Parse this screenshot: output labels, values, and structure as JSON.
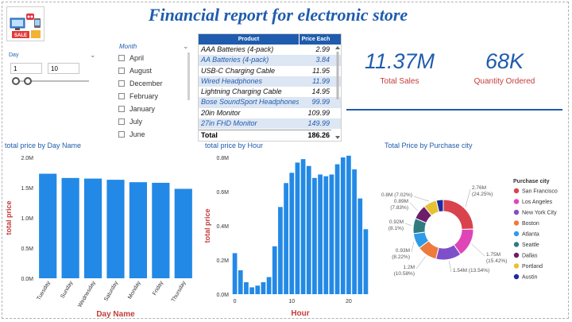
{
  "title": "Financial report for electronic store",
  "logo": {
    "badge_text": "SALE"
  },
  "day_filter": {
    "label": "Day",
    "min": "1",
    "max": "10"
  },
  "month_filter": {
    "label": "Month",
    "items": [
      "April",
      "August",
      "December",
      "February",
      "January",
      "July",
      "June"
    ]
  },
  "product_table": {
    "headers": [
      "Product",
      "Price Each"
    ],
    "rows": [
      [
        "AAA Batteries (4-pack)",
        "2.99"
      ],
      [
        "AA Batteries (4-pack)",
        "3.84"
      ],
      [
        "USB-C Charging Cable",
        "11.95"
      ],
      [
        "Wired Headphones",
        "11.99"
      ],
      [
        "Lightning Charging Cable",
        "14.95"
      ],
      [
        "Bose SoundSport Headphones",
        "99.99"
      ],
      [
        "20in Monitor",
        "109.99"
      ],
      [
        "27in FHD Monitor",
        "149.99"
      ]
    ],
    "total_label": "Total",
    "total_value": "186.26"
  },
  "kpis": {
    "total_sales_value": "11.37M",
    "total_sales_label": "Total Sales",
    "quantity_value": "68K",
    "quantity_label": "Quantity Ordered"
  },
  "colors": {
    "accent": "#1f5cad",
    "bar": "#2389e6",
    "label_red": "#c43b3b"
  },
  "chart_data": [
    {
      "type": "bar",
      "title": "total price by Day Name",
      "xlabel": "Day Name",
      "ylabel": "total price",
      "categories": [
        "Tuesday",
        "Sunday",
        "Wednesday",
        "Saturday",
        "Monday",
        "Friday",
        "Thursday"
      ],
      "values": [
        1.73,
        1.66,
        1.65,
        1.63,
        1.59,
        1.58,
        1.48
      ],
      "ylim": [
        0,
        2.0
      ],
      "yticks": [
        "0.0M",
        "0.5M",
        "1.0M",
        "1.5M",
        "2.0M"
      ]
    },
    {
      "type": "bar",
      "title": "total price by Hour",
      "xlabel": "Hour",
      "ylabel": "total price",
      "x": [
        0,
        1,
        2,
        3,
        4,
        5,
        6,
        7,
        8,
        9,
        10,
        11,
        12,
        13,
        14,
        15,
        16,
        17,
        18,
        19,
        20,
        21,
        22,
        23
      ],
      "values": [
        0.24,
        0.14,
        0.07,
        0.04,
        0.05,
        0.07,
        0.1,
        0.28,
        0.51,
        0.65,
        0.71,
        0.77,
        0.79,
        0.75,
        0.68,
        0.7,
        0.69,
        0.7,
        0.76,
        0.8,
        0.81,
        0.73,
        0.56,
        0.38
      ],
      "ylim": [
        0,
        0.8
      ],
      "yticks": [
        "0.0M",
        "0.2M",
        "0.4M",
        "0.6M",
        "0.8M"
      ],
      "xticks": [
        "0",
        "10",
        "20"
      ]
    },
    {
      "type": "pie",
      "title": "Total Price by Purchase city",
      "legend_title": "Purchase city",
      "slices": [
        {
          "name": "San Francisco",
          "value": 2.76,
          "label": "2.76M",
          "pct": "(24.25%)",
          "color": "#d9434e"
        },
        {
          "name": "Los Angeles",
          "value": 1.75,
          "label": "1.75M",
          "pct": "(15.42%)",
          "color": "#e045b8"
        },
        {
          "name": "New York City",
          "value": 1.54,
          "label": "1.54M (13.54%)",
          "pct": "",
          "color": "#7f4fc9"
        },
        {
          "name": "Boston",
          "value": 1.2,
          "label": "1.2M",
          "pct": "(10.58%)",
          "color": "#ee7a3c"
        },
        {
          "name": "Atlanta",
          "value": 0.93,
          "label": "0.93M",
          "pct": "(8.22%)",
          "color": "#2f9be8"
        },
        {
          "name": "Seattle",
          "value": 0.92,
          "label": "0.92M",
          "pct": "(8.1%)",
          "color": "#2f7b80"
        },
        {
          "name": "Dallas",
          "value": 0.89,
          "label": "0.89M",
          "pct": "(7.83%)",
          "color": "#6d1e6a"
        },
        {
          "name": "Portland",
          "value": 0.8,
          "label": "0.8M (7.02%)",
          "pct": "",
          "color": "#e6c233"
        },
        {
          "name": "Austin",
          "value": 0.42,
          "label": "",
          "pct": "",
          "color": "#1d2b9e"
        }
      ]
    }
  ]
}
